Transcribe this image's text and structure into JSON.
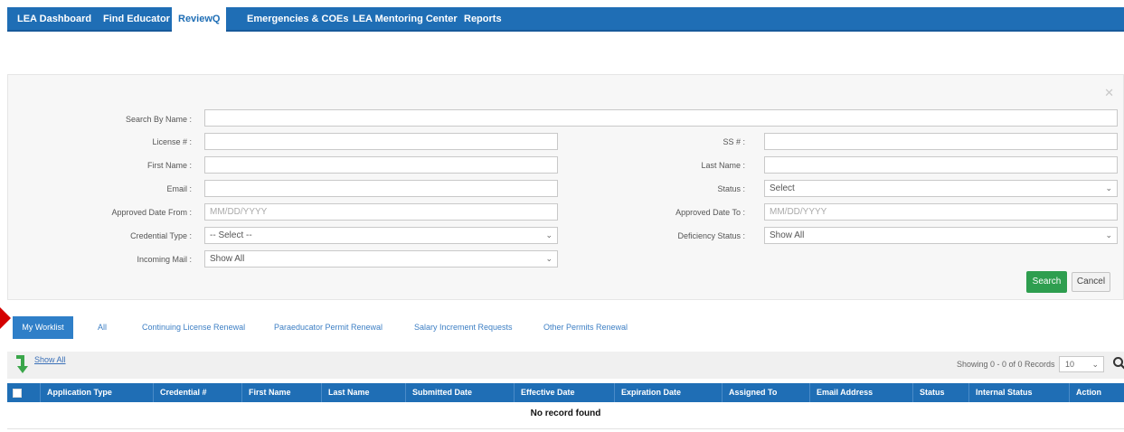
{
  "nav": {
    "items": [
      {
        "label": "LEA Dashboard"
      },
      {
        "label": "Find Educator"
      },
      {
        "label": "ReviewQ"
      },
      {
        "label": "Emergencies & COEs"
      },
      {
        "label": "LEA Mentoring Center"
      },
      {
        "label": "Reports"
      }
    ],
    "active_index": 2
  },
  "search_panel": {
    "close_glyph": "✕",
    "search_by_name_label": "Search By Name :",
    "license_label": "License # :",
    "ss_label": "SS # :",
    "first_name_label": "First Name :",
    "last_name_label": "Last Name :",
    "email_label": "Email :",
    "status_label": "Status :",
    "status_value": "Select",
    "approved_from_label": "Approved Date From :",
    "approved_from_placeholder": "MM/DD/YYYY",
    "approved_to_label": "Approved Date To :",
    "approved_to_placeholder": "MM/DD/YYYY",
    "credential_type_label": "Credential Type :",
    "credential_type_value": "-- Select --",
    "deficiency_status_label": "Deficiency Status :",
    "deficiency_status_value": "Show All",
    "incoming_mail_label": "Incoming Mail :",
    "incoming_mail_value": "Show All",
    "search_button": "Search",
    "cancel_button": "Cancel"
  },
  "tabs": [
    {
      "label": "My Worklist"
    },
    {
      "label": "All"
    },
    {
      "label": "Continuing License Renewal"
    },
    {
      "label": "Paraeducator Permit Renewal"
    },
    {
      "label": "Salary Increment Requests"
    },
    {
      "label": "Other Permits Renewal"
    }
  ],
  "grid": {
    "show_all": "Show All",
    "showing_text": "Showing 0 - 0 of 0 Records",
    "page_size": "10",
    "columns": [
      "Application Type",
      "Credential #",
      "First Name",
      "Last Name",
      "Submitted Date",
      "Effective Date",
      "Expiration Date",
      "Assigned To",
      "Email Address",
      "Status",
      "Internal Status",
      "Action"
    ],
    "empty_message": "No record found"
  },
  "colors": {
    "nav_blue": "#1f6eb5",
    "search_green": "#2e9e4f",
    "pointer_red": "#d40000"
  }
}
